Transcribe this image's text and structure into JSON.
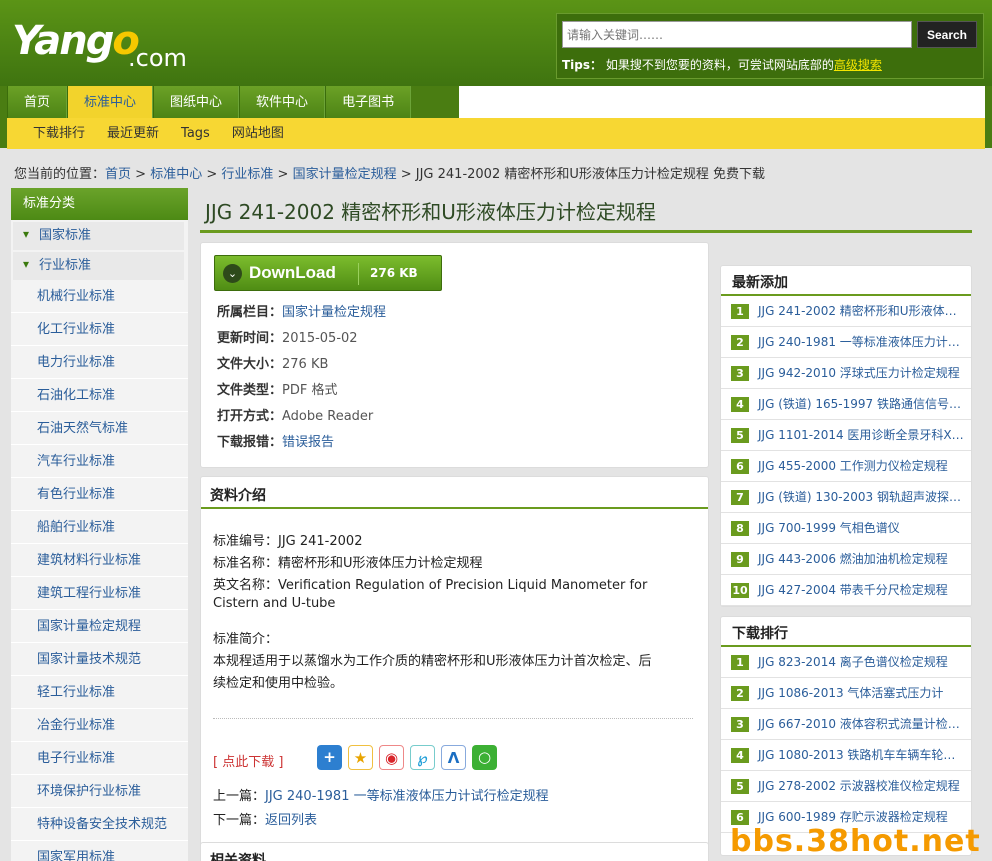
{
  "logo": {
    "main": "Yang",
    "o": "o",
    "suffix": ".com"
  },
  "search": {
    "placeholder": "请输入关键词……",
    "button": "Search",
    "tips_label": "Tips：",
    "tips_text": "如果搜不到您要的资料，可尝试网站底部的",
    "tips_link": "高级搜索"
  },
  "nav": [
    "首页",
    "标准中心",
    "图纸中心",
    "软件中心",
    "电子图书"
  ],
  "subnav": [
    "下载排行",
    "最近更新",
    "Tags",
    "网站地图"
  ],
  "breadcrumb": {
    "prefix": "您当前的位置：",
    "items": [
      "首页",
      "标准中心",
      "行业标准",
      "国家计量检定规程"
    ],
    "current": "JJG 241-2002 精密杯形和U形液体压力计检定规程 免费下载"
  },
  "sidebar": {
    "title": "标准分类",
    "groups": [
      "国家标准",
      "行业标准"
    ],
    "items": [
      "机械行业标准",
      "化工行业标准",
      "电力行业标准",
      "石油化工标准",
      "石油天然气标准",
      "汽车行业标准",
      "有色行业标准",
      "船舶行业标准",
      "建筑材料行业标准",
      "建筑工程行业标准",
      "国家计量检定规程",
      "国家计量技术规范",
      "轻工行业标准",
      "冶金行业标准",
      "电子行业标准",
      "环境保护行业标准",
      "特种设备安全技术规范",
      "国家军用标准"
    ]
  },
  "title": "JJG 241-2002 精密杯形和U形液体压力计检定规程",
  "download": {
    "label": "DownLoad",
    "size": "276 KB"
  },
  "meta": [
    {
      "k": "所属栏目：",
      "v": "国家计量检定规程",
      "link": true
    },
    {
      "k": "更新时间：",
      "v": "2015-05-02",
      "link": false
    },
    {
      "k": "文件大小：",
      "v": "276 KB",
      "link": false
    },
    {
      "k": "文件类型：",
      "v": "PDF 格式",
      "link": false
    },
    {
      "k": "打开方式：",
      "v": "Adobe Reader",
      "link": false
    },
    {
      "k": "下载报错：",
      "v": "错误报告",
      "link": true
    }
  ],
  "intro": {
    "heading": "资料介绍",
    "lines": [
      "标准编号：JJG 241-2002",
      "标准名称：精密杯形和U形液体压力计检定规程",
      "英文名称：Verification Regulation of Precision Liquid Manometer for",
      "Cistern and U-tube",
      "标准简介：",
      "本规程适用于以蒸馏水为工作介质的精密杯形和U形液体压力计首次检定、后",
      "续检定和使用中检验。"
    ],
    "click": "[ 点此下载 ]",
    "prev_label": "上一篇：",
    "prev": "JJG 240-1981 一等标准液体压力计试行检定规程",
    "next_label": "下一篇：",
    "next": "返回列表",
    "related": "相关资料"
  },
  "latest": {
    "title": "最新添加",
    "items": [
      "JJG 241-2002 精密杯形和U形液体…",
      "JJG 240-1981 一等标准液体压力计…",
      "JJG 942-2010 浮球式压力计检定规程",
      "JJG (铁道) 165-1997 铁路通信信号…",
      "JJG 1101-2014 医用诊断全景牙科X…",
      "JJG 455-2000 工作测力仪检定规程",
      "JJG (铁道) 130-2003 钢轨超声波探…",
      "JJG 700-1999 气相色谱仪",
      "JJG 443-2006 燃油加油机检定规程",
      "JJG 427-2004 带表千分尺检定规程"
    ]
  },
  "ranking": {
    "title": "下载排行",
    "items": [
      "JJG 823-2014 离子色谱仪检定规程",
      "JJG 1086-2013 气体活塞式压力计",
      "JJG 667-2010 液体容积式流量计检…",
      "JJG 1080-2013 铁路机车车辆车轮…",
      "JJG 278-2002 示波器校准仪检定规程",
      "JJG 600-1989 存贮示波器检定规程"
    ]
  },
  "watermark": "bbs.38hot.net",
  "colors": {
    "brand_green": "#4a7d12",
    "nav_active": "#f2d32c",
    "link": "#2a5d9a"
  }
}
